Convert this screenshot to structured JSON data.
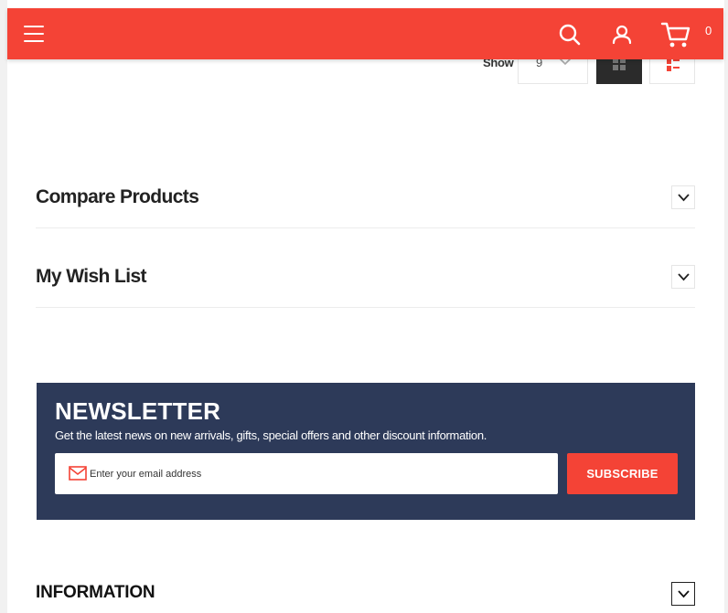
{
  "header": {
    "cart_count": "0",
    "icons": {
      "menu": "hamburger-icon",
      "search": "search-icon",
      "account": "user-icon",
      "cart": "cart-icon"
    },
    "brand_color": "#f44336"
  },
  "toolbar": {
    "show_label": "Show",
    "limiter_value": "9",
    "view_modes": [
      "grid",
      "list"
    ]
  },
  "blocks": {
    "compare_title": "Compare Products",
    "wishlist_title": "My Wish List"
  },
  "newsletter": {
    "title": "NEWSLETTER",
    "description": "Get the latest news on new arrivals, gifts, special offers and other discount information.",
    "placeholder": "Enter your email address",
    "button_label": "SUBSCRIBE",
    "background_color": "#2d3a59"
  },
  "footer": {
    "information_title": "INFORMATION"
  }
}
